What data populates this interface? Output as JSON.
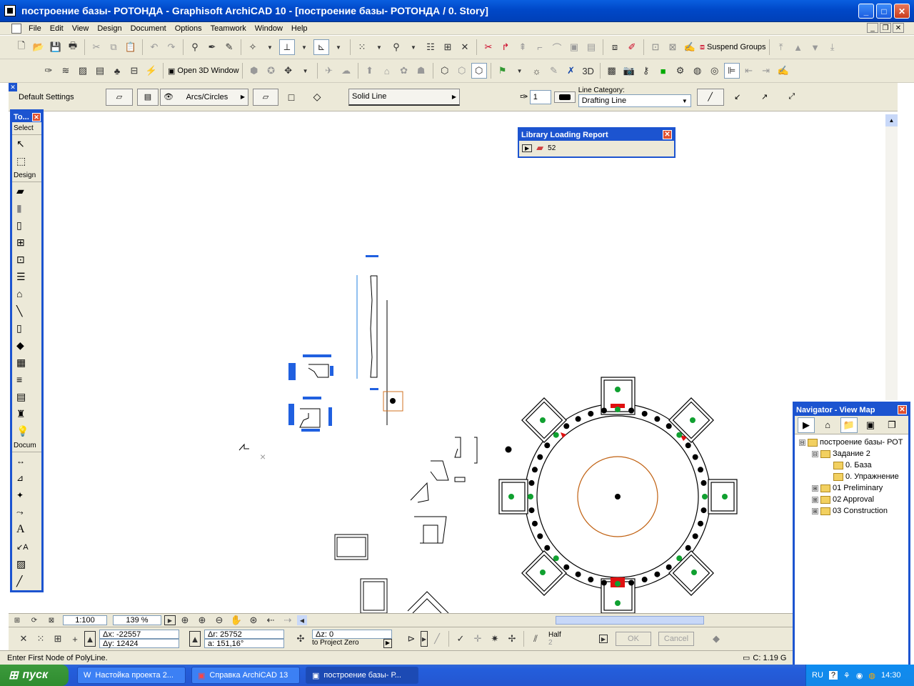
{
  "window": {
    "title": "построение базы- РОТОНДА - Graphisoft ArchiCAD 10 - [построение базы- РОТОНДА / 0. Story]"
  },
  "menu": [
    "File",
    "Edit",
    "View",
    "Design",
    "Document",
    "Options",
    "Teamwork",
    "Window",
    "Help"
  ],
  "toolbar": {
    "suspend_groups": "Suspend Groups",
    "open_3d": "Open 3D Window"
  },
  "infobox": {
    "default_settings": "Default Settings",
    "geometry": "Arcs/Circles",
    "line_type": "Solid Line",
    "pen": "1",
    "line_category_label": "Line Category:",
    "line_category": "Drafting Line"
  },
  "toolbox": {
    "title": "To...",
    "sections": {
      "select": "Select",
      "design": "Design",
      "document": "Docum"
    }
  },
  "library_report": {
    "title": "Library Loading Report",
    "count": "52"
  },
  "navigator": {
    "title": "Navigator - View Map",
    "tree": [
      {
        "label": "построение базы- РОТ",
        "level": 0,
        "expander": "⊟"
      },
      {
        "label": "Задание 2",
        "level": 1,
        "expander": "⊟"
      },
      {
        "label": "0. База",
        "level": 2,
        "expander": ""
      },
      {
        "label": "0. Упражнение",
        "level": 2,
        "expander": ""
      },
      {
        "label": "01 Preliminary",
        "level": 1,
        "expander": "⊞"
      },
      {
        "label": "02 Approval",
        "level": 1,
        "expander": "⊞"
      },
      {
        "label": "03 Construction",
        "level": 1,
        "expander": "⊞"
      }
    ]
  },
  "view": {
    "scale": "1:100",
    "zoom": "139 %"
  },
  "coords": {
    "dx": "Δx: -22557",
    "dy": "Δy: 12424",
    "dr": "Δr: 25752",
    "angle": "a: 151,16°",
    "dz": "Δz: 0",
    "to_project_zero": "to Project Zero",
    "half": "Half",
    "half_num": "2",
    "ok": "OK",
    "cancel": "Cancel"
  },
  "status": {
    "message": "Enter First Node of PolyLine.",
    "disk": "C: 1.19 G"
  },
  "taskbar": {
    "start": "пуск",
    "tasks": [
      "Настойка проекта 2...",
      "Справка ArchiCAD 13",
      "построение базы- Р..."
    ],
    "lang": "RU",
    "time": "14:30"
  }
}
